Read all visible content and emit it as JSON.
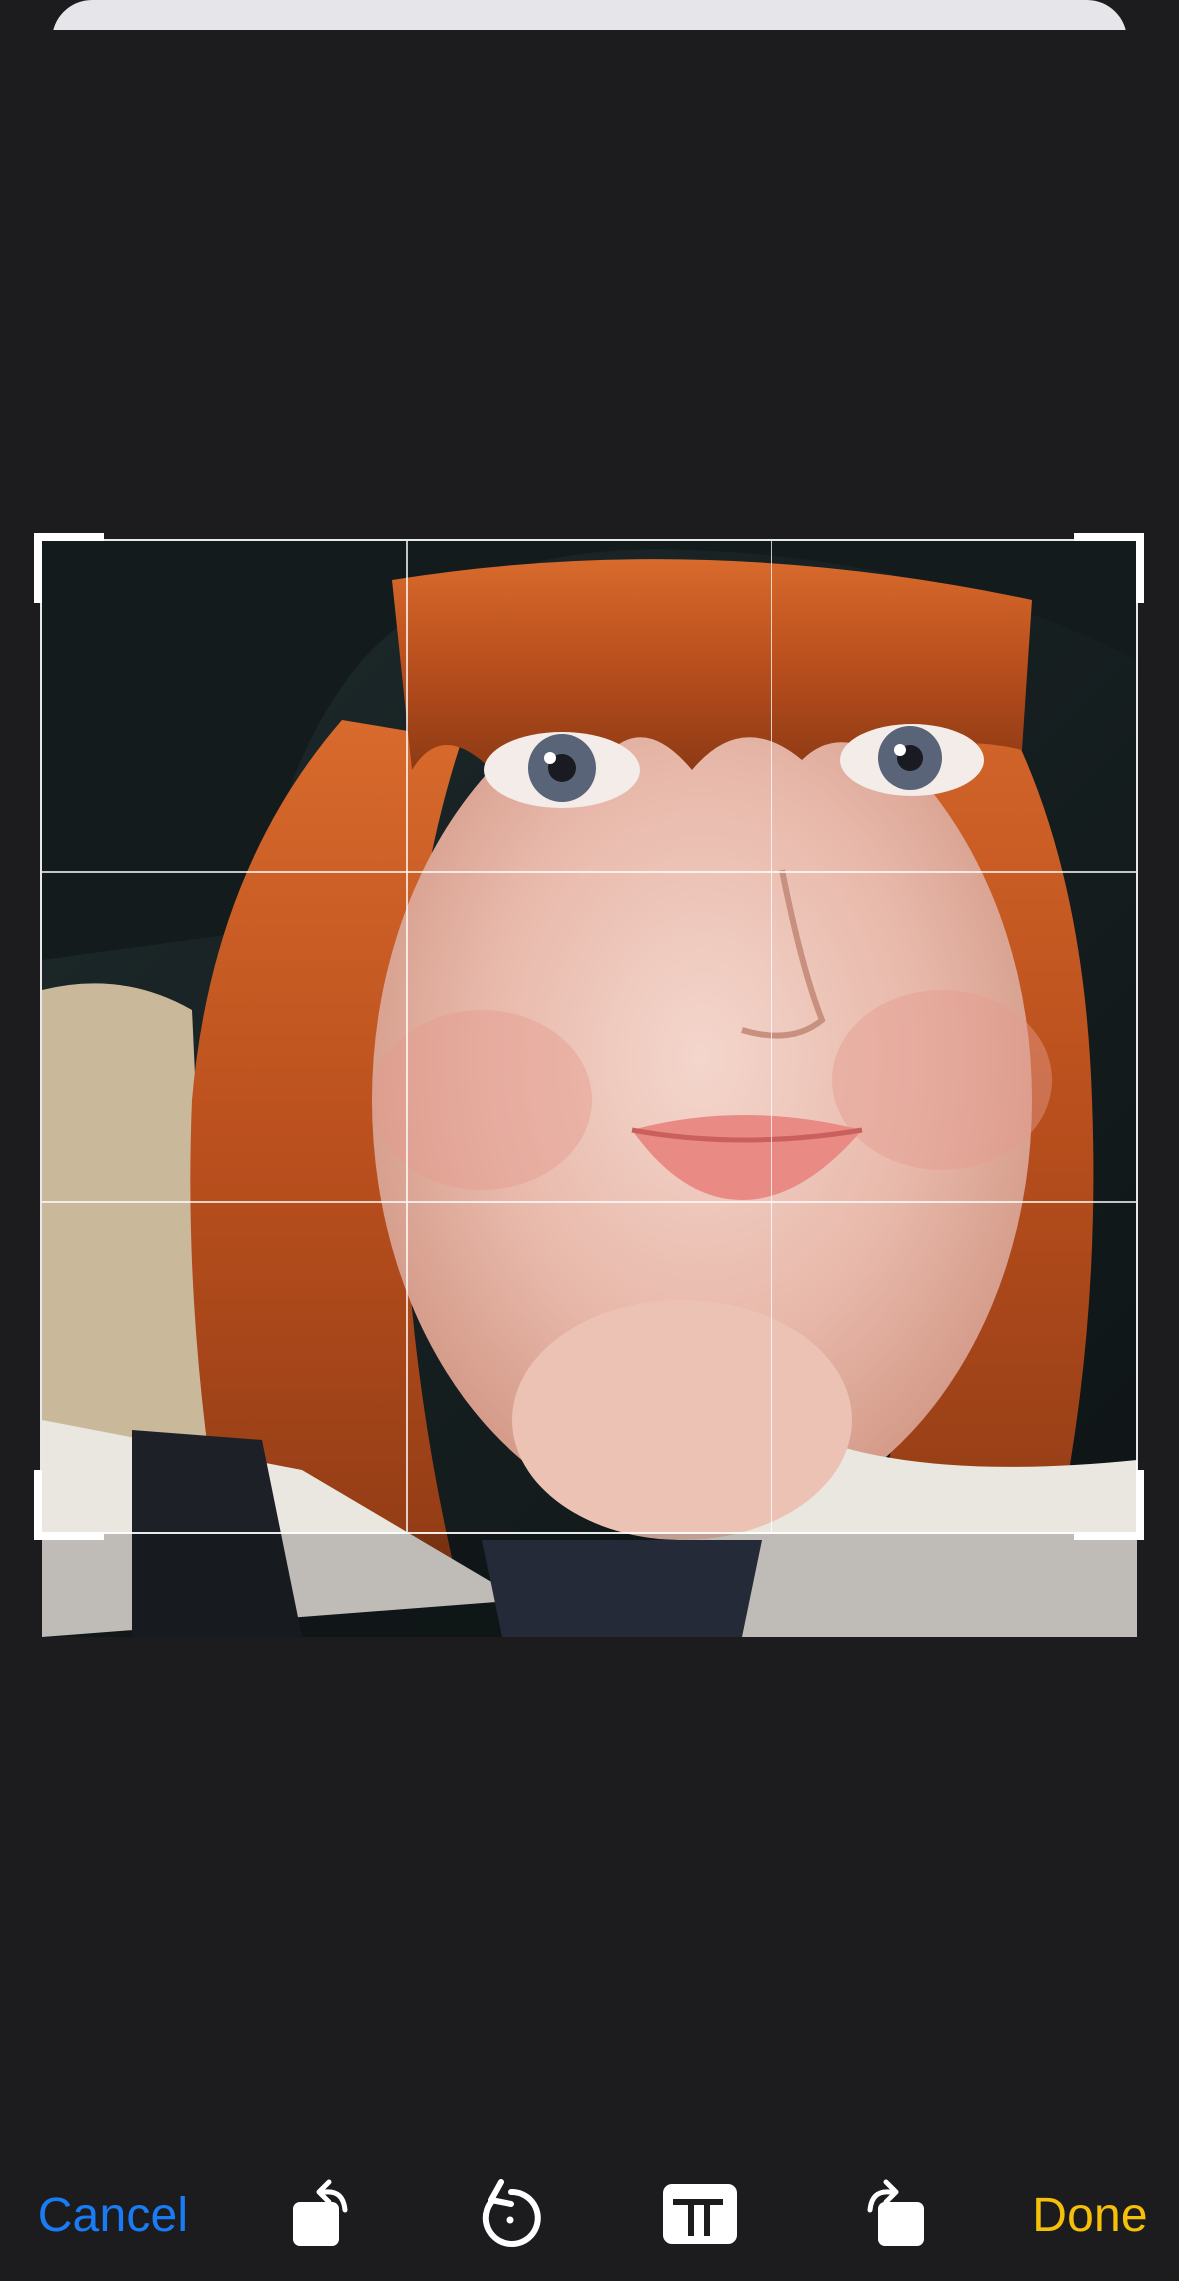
{
  "toolbar": {
    "cancel_label": "Cancel",
    "done_label": "Done",
    "cancel_color": "#1a7cf5",
    "done_color": "#f5bf0a",
    "icons": [
      "rotate-left-icon",
      "undo-rotate-icon",
      "aspect-ratio-icon",
      "rotate-right-icon"
    ]
  },
  "editor": {
    "mode": "crop",
    "grid": "3x3"
  }
}
